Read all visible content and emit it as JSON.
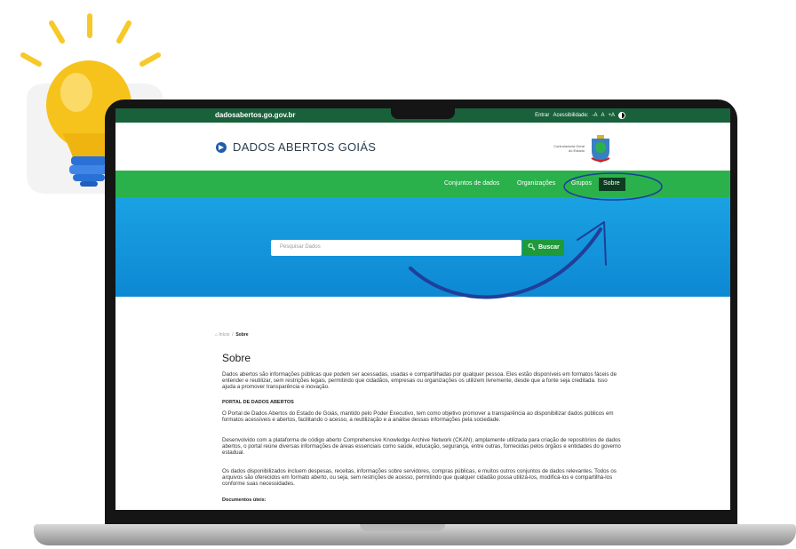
{
  "browser": {
    "domain": "dadosabertos.go.gov.br"
  },
  "topbar": {
    "entrar": "Entrar",
    "acessibilidade": "Acessibilidade:",
    "font_minus": "-A",
    "font_reset": "A",
    "font_plus": "+A"
  },
  "header": {
    "logo_text": "DADOS ABERTOS GOIÁS",
    "state_label": "Controladoria Geral do Estado"
  },
  "nav": {
    "items": [
      "Conjuntos de dados",
      "Organizações",
      "Grupos",
      "Sobre"
    ],
    "active": "Sobre"
  },
  "search": {
    "placeholder": "Pesquisar Dados",
    "button_label": "Buscar"
  },
  "breadcrumb": {
    "home": "Início",
    "current": "Sobre"
  },
  "content": {
    "title": "Sobre",
    "p1": "Dados abertos são informações públicas que podem ser acessadas, usadas e compartilhadas por qualquer pessoa. Eles estão disponíveis em formatos fáceis de entender e reutilizar, sem restrições legais, permitindo que cidadãos, empresas ou organizações os utilizem livremente, desde que a fonte seja creditada. Isso ajuda a promover transparência e inovação.",
    "section_title": "PORTAL DE DADOS ABERTOS",
    "p2": "O Portal de Dados Abertos do Estado de Goiás, mantido pelo Poder Executivo, tem como objetivo promover a transparência ao disponibilizar dados públicos em formatos acessíveis e abertos, facilitando o acesso, a reutilização e a análise dessas informações pela sociedade.",
    "p3": "Desenvolvido com a plataforma de código aberto Comprehensive Knowledge Archive Network (CKAN), amplamente utilizada para criação de repositórios de dados abertos, o portal reúne diversas informações de áreas essenciais como saúde, educação, segurança, entre outras, fornecidas pelos órgãos e entidades do governo estadual.",
    "p4": "Os dados disponibilizados incluem despesas, receitas, informações sobre servidores, compras públicas, e muitos outros conjuntos de dados relevantes. Todos os arquivos são oferecidos em formato aberto, ou seja, sem restrições de acesso, permitindo que qualquer cidadão possa utilizá-los, modificá-los e compartilhá-los conforme suas necessidades.",
    "docs_label": "Documentos úteis:"
  },
  "colors": {
    "topbar": "#18613a",
    "nav": "#2bb14c",
    "hero": "#1aa2e3",
    "annotation": "#1f3f9a",
    "bulb": "#f7c928"
  }
}
